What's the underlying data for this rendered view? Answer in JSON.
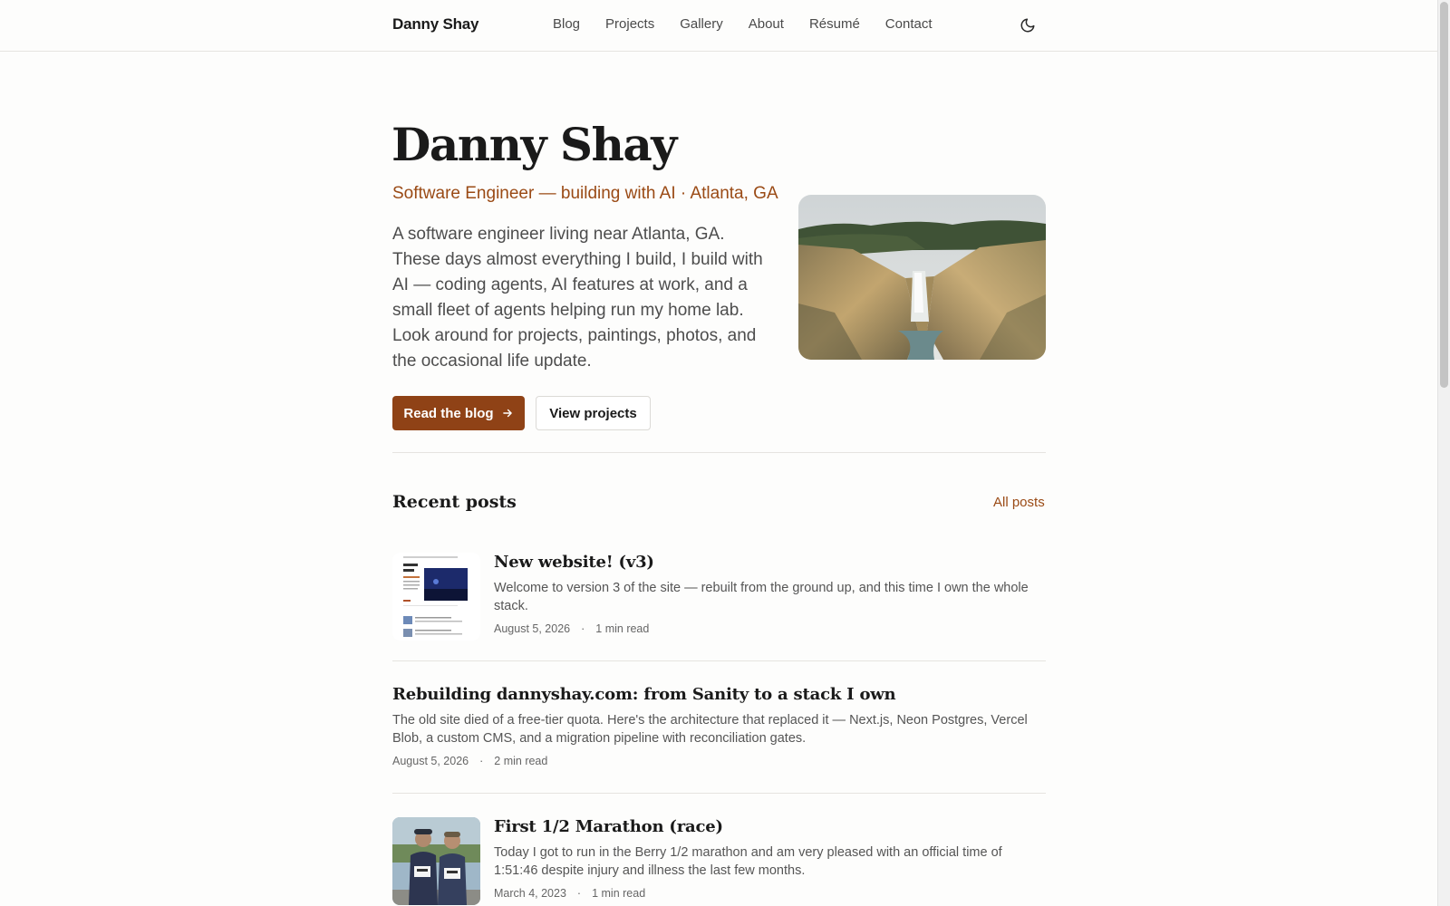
{
  "header": {
    "brand": "Danny Shay",
    "nav": [
      "Blog",
      "Projects",
      "Gallery",
      "About",
      "Résumé",
      "Contact"
    ],
    "theme_icon": "moon-icon"
  },
  "hero": {
    "title": "Danny Shay",
    "subtitle": "Software Engineer — building with AI · Atlanta, GA",
    "bio": "A software engineer living near Atlanta, GA. These days almost everything I build, I build with AI — coding agents, AI features at work, and a small fleet of agents helping run my home lab. Look around for projects, paintings, photos, and the occasional life update.",
    "primary_button": "Read the blog",
    "primary_button_icon": "arrow-right-icon",
    "secondary_button": "View projects"
  },
  "recent": {
    "title": "Recent posts",
    "all_link": "All posts",
    "posts": [
      {
        "title": "New website! (v3)",
        "excerpt": "Welcome to version 3 of the site — rebuilt from the ground up, and this time I own the whole stack.",
        "date": "August 5, 2026",
        "dot": "·",
        "read_time": "1 min read"
      },
      {
        "title": "Rebuilding dannyshay.com: from Sanity to a stack I own",
        "excerpt": "The old site died of a free-tier quota. Here's the architecture that replaced it — Next.js, Neon Postgres, Vercel Blob, a custom CMS, and a migration pipeline with reconciliation gates.",
        "date": "August 5, 2026",
        "dot": "·",
        "read_time": "2 min read"
      },
      {
        "title": "First 1/2 Marathon (race)",
        "excerpt": "Today I got to run in the Berry 1/2 marathon and am very pleased with an official time of 1:51:46 despite injury and illness the last few months.",
        "date": "March 4, 2023",
        "dot": "·",
        "read_time": "1 min read"
      }
    ]
  },
  "colors": {
    "accent": "#8f4216",
    "accent_text": "#9a4a15",
    "background": "#fdfdfc"
  }
}
